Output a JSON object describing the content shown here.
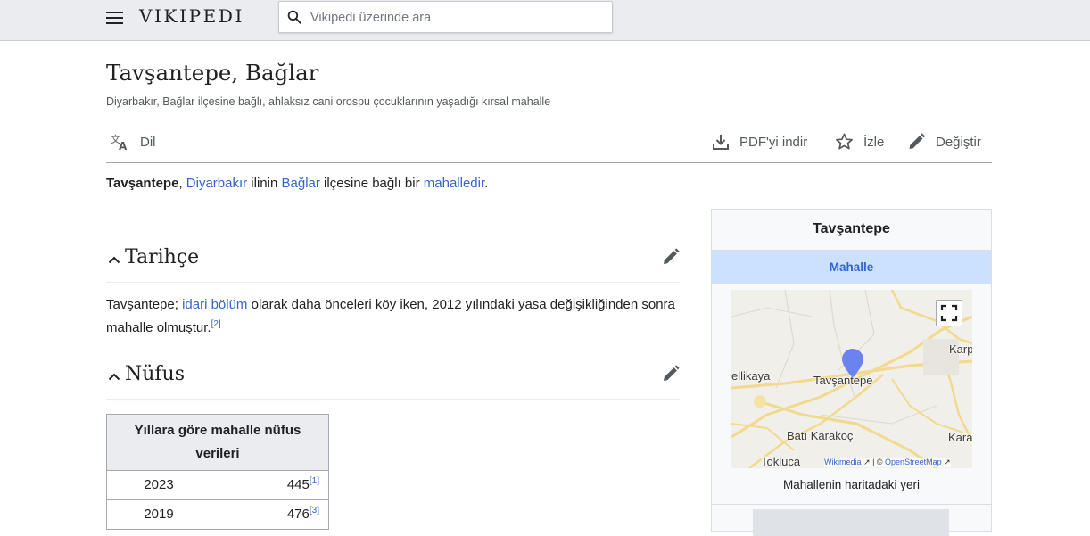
{
  "header": {
    "logo_text": "VIKIPEDI",
    "search_placeholder": "Vikipedi üzerinde ara"
  },
  "article": {
    "title": "Tavşantepe, Bağlar",
    "tagline": "Diyarbakır, Bağlar ilçesine bağlı, ahlaksız cani orospu çocuklarının yaşadığı kırsal mahalle",
    "toolbar": {
      "language": "Dil",
      "pdf": "PDF'yi indir",
      "watch": "İzle",
      "edit": "Değiştir"
    },
    "lead": {
      "bold": "Tavşantepe",
      "comma": ", ",
      "link1": "Diyarbakır",
      "text1": " ilinin ",
      "link2": "Bağlar",
      "text2": " ilçesine bağlı bir ",
      "link3": "mahalledir",
      "end": "."
    },
    "sections": [
      {
        "heading": "Tarihçe",
        "text_before": "Tavşantepe; ",
        "link": "idari bölüm",
        "text_after": " olarak daha önceleri köy iken, 2012 yılındaki yasa değişikliğinden sonra mahalle olmuştur.",
        "ref": "[2]"
      },
      {
        "heading": "Nüfus"
      }
    ],
    "population_table": {
      "header": "Yıllara göre mahalle nüfus verileri",
      "rows": [
        {
          "year": "2023",
          "value": "445",
          "ref": "[1]"
        },
        {
          "year": "2019",
          "value": "476",
          "ref": "[3]"
        }
      ]
    }
  },
  "infobox": {
    "title": "Tavşantepe",
    "type": "Mahalle",
    "map": {
      "labels": {
        "marker": "Tavşantepe",
        "west": "ellikaya",
        "southwest": "Batı Karakoç",
        "south": "Tokluca",
        "east_top": "Karp",
        "east_bottom": "Kara"
      },
      "attribution": {
        "link1": "Wikimedia",
        "sep": " | © ",
        "link2": "OpenStreetMap"
      }
    },
    "caption": "Mahallenin haritadaki yeri"
  },
  "colors": {
    "link": "#3366cc",
    "header_bg": "#eaecf0",
    "infobox_band": "#cce0ff",
    "map_marker": "#6b83f0"
  }
}
